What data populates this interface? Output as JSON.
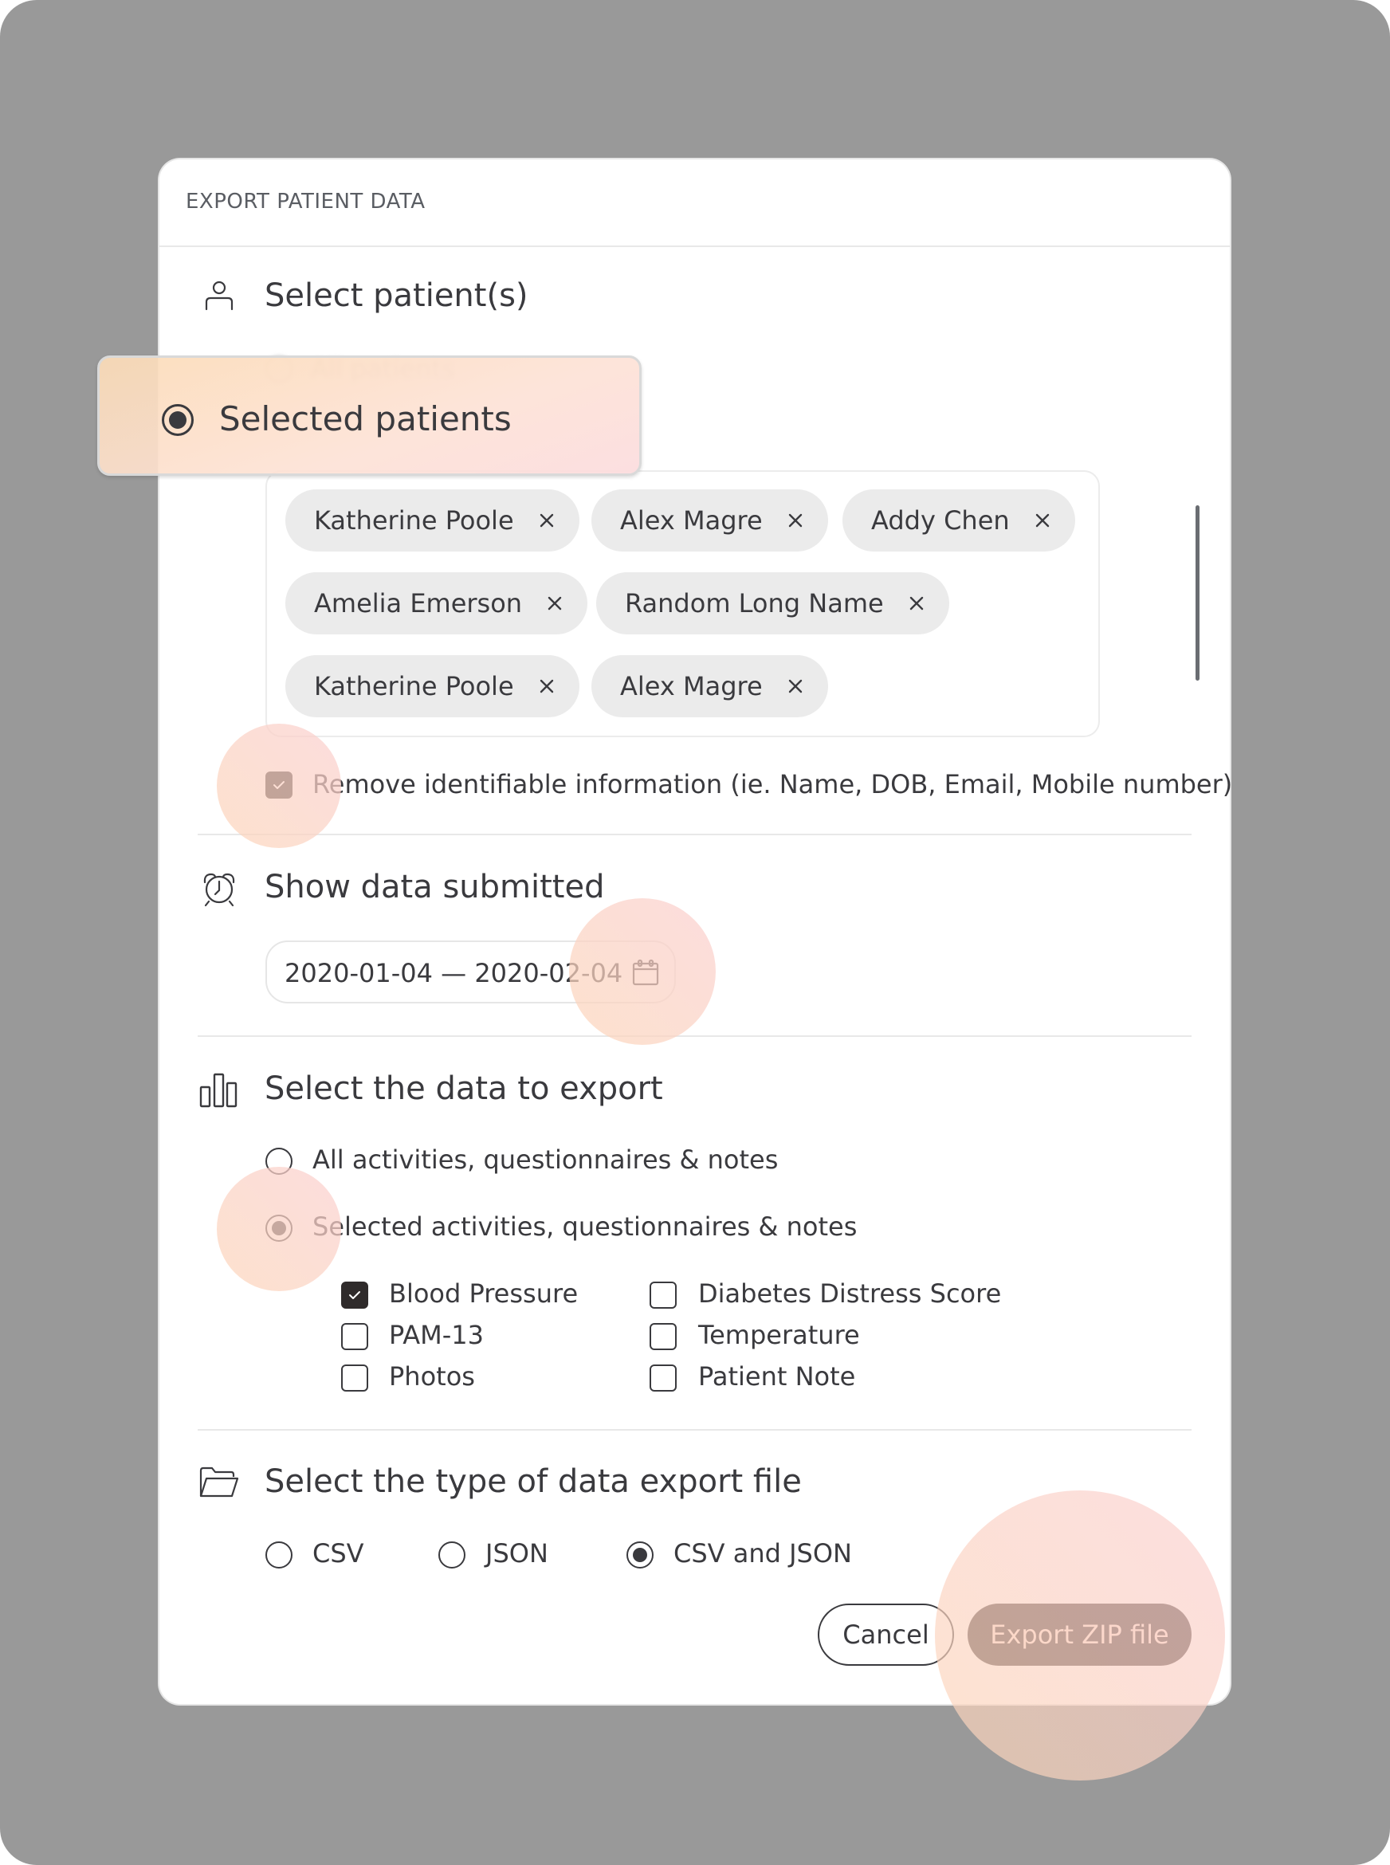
{
  "modal": {
    "title": "EXPORT PATIENT DATA"
  },
  "patients_section": {
    "icon": "person-icon",
    "title": "Select patient(s)",
    "options": [
      {
        "label": "All patients",
        "selected": false
      },
      {
        "label": "Selected patients",
        "selected": true
      }
    ],
    "selected_patients": [
      "Katherine Poole",
      "Alex Magre",
      "Addy Chen",
      "Amelia Emerson",
      "Random Long Name",
      "Katherine Poole",
      "Alex Magre"
    ],
    "remove_identifiable": {
      "label": "Remove identifiable information (ie. Name, DOB, Email, Mobile number)",
      "checked": true
    }
  },
  "date_section": {
    "icon": "alarm-clock-icon",
    "title": "Show data submitted",
    "date_range": "2020-01-04 — 2020-02-04",
    "calendar_icon": "calendar-icon"
  },
  "data_section": {
    "icon": "bar-chart-icon",
    "title": "Select the data to export",
    "options": [
      {
        "label": "All activities, questionnaires & notes",
        "selected": false
      },
      {
        "label": "Selected activities, questionnaires & notes",
        "selected": true
      }
    ],
    "items": [
      {
        "label": "Blood Pressure",
        "checked": true
      },
      {
        "label": "PAM-13",
        "checked": false
      },
      {
        "label": "Photos",
        "checked": false
      },
      {
        "label": "Diabetes Distress Score",
        "checked": false
      },
      {
        "label": "Temperature",
        "checked": false
      },
      {
        "label": "Patient Note",
        "checked": false
      }
    ]
  },
  "file_section": {
    "icon": "folder-open-icon",
    "title": "Select the type of data export file",
    "options": [
      {
        "label": "CSV",
        "selected": false
      },
      {
        "label": "JSON",
        "selected": false
      },
      {
        "label": "CSV and JSON",
        "selected": true
      }
    ]
  },
  "actions": {
    "cancel_label": "Cancel",
    "export_label": "Export ZIP file"
  },
  "colors": {
    "backdrop": "#999999",
    "primary_button": "#433a39",
    "primary_button_text": "#fbe2d6",
    "text": "#3a3a3e",
    "chip": "#ebebeb"
  }
}
